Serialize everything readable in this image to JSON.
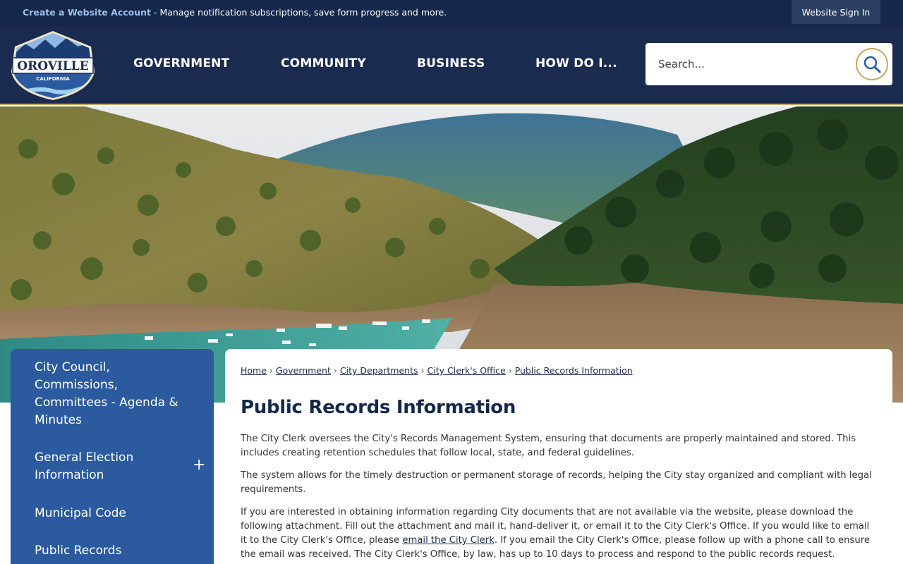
{
  "topbar": {
    "create_link": "Create a Website Account",
    "message": " - Manage notification subscriptions, save form progress and more.",
    "signin_label": "Website Sign In"
  },
  "logo": {
    "name": "OROVILLE",
    "state": "CALIFORNIA"
  },
  "nav": {
    "items": [
      {
        "label": "GOVERNMENT"
      },
      {
        "label": "COMMUNITY"
      },
      {
        "label": "BUSINESS"
      },
      {
        "label": "HOW DO I..."
      }
    ]
  },
  "search": {
    "placeholder": "Search...",
    "icon": "search-icon"
  },
  "sidebar": {
    "items": [
      {
        "label": "City Council, Commissions, Committees - Agenda & Minutes"
      },
      {
        "label": "General Election Information",
        "expandable": true,
        "toggle": "+"
      },
      {
        "label": "Municipal Code"
      },
      {
        "label": "Public Records"
      }
    ]
  },
  "breadcrumb": {
    "items": [
      {
        "label": "Home"
      },
      {
        "label": "Government"
      },
      {
        "label": "City Departments"
      },
      {
        "label": "City Clerk's Office"
      },
      {
        "label": "Public Records Information"
      }
    ],
    "separator": "›"
  },
  "main": {
    "title": "Public Records Information",
    "para1": "The City Clerk oversees the City's Records Management System, ensuring that documents are properly maintained and stored. This includes creating retention schedules that follow local, state, and federal guidelines.",
    "para2": "The system allows for the timely destruction or permanent storage of records, helping the City stay organized and compliant with legal requirements.",
    "para3_before": "If you are interested in obtaining information regarding City documents that are not available via the website, please download the following attachment. Fill out the attachment and mail it, hand-deliver it, or email it to the City Clerk's Office. If you would like to email it to the City Clerk's Office, please ",
    "para3_link": "email the City Clerk",
    "para3_after": ". If you email the City Clerk's Office, please follow up with a phone call to ensure the email was received. The City Clerk's Office, by law, has up to 10 days to process and respond to the public records request."
  },
  "colors": {
    "topbar": "#15284b",
    "header": "#1b2b50",
    "accent_gold": "#c9a860",
    "sidebar": "#2c5a9e",
    "title": "#15284b"
  }
}
